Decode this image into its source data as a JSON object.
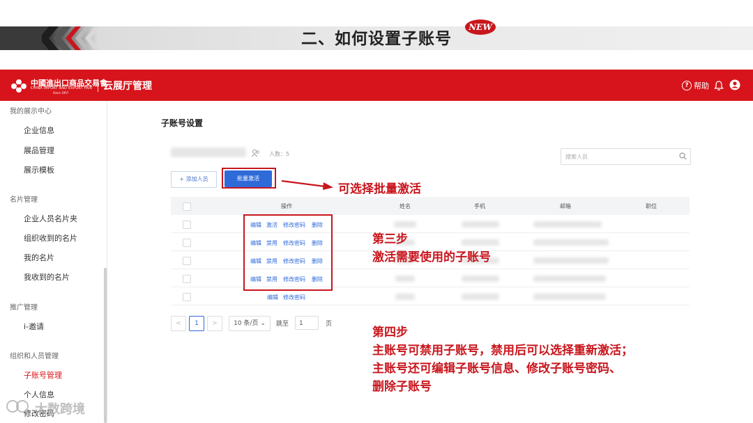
{
  "slide": {
    "title": "二、如何设置子账号",
    "badge": "NEW"
  },
  "header": {
    "logo_cn": "中國進出口商品交易會",
    "logo_en": "CHINA IMPORT AND EXPORT FAIR",
    "logo_since": "Since 1957",
    "app_title": "云展厅管理",
    "help_label": "帮助",
    "brand_color": "#d7141b"
  },
  "sidebar": {
    "groups": [
      {
        "title": "我的展示中心",
        "items": [
          "企业信息",
          "展品管理",
          "展示模板"
        ]
      },
      {
        "title": "名片管理",
        "items": [
          "企业人员名片夹",
          "组织收到的名片",
          "我的名片",
          "我收到的名片"
        ]
      },
      {
        "title": "推广管理",
        "items": [
          "i-邀请"
        ]
      },
      {
        "title": "组织和人员管理",
        "items": [
          "子账号管理",
          "个人信息",
          "修改密码"
        ]
      }
    ],
    "active_item": "子账号管理"
  },
  "main": {
    "page_title": "子账号设置",
    "member_count": "人数：5",
    "search_placeholder": "搜索人员",
    "add_button": "添加人员",
    "batch_button": "批量激活",
    "columns": [
      "操作",
      "姓名",
      "手机",
      "邮箱",
      "职位"
    ],
    "rows": [
      {
        "actions": [
          "编辑",
          "激活",
          "修改密码",
          "删除"
        ]
      },
      {
        "actions": [
          "编辑",
          "禁用",
          "修改密码",
          "删除"
        ]
      },
      {
        "actions": [
          "编辑",
          "禁用",
          "修改密码",
          "删除"
        ]
      },
      {
        "actions": [
          "编辑",
          "禁用",
          "修改密码",
          "删除"
        ]
      },
      {
        "actions": [
          "编辑",
          "修改密码"
        ]
      }
    ],
    "pagination": {
      "prev": "<",
      "current_page": "1",
      "next": ">",
      "page_size": "10 条/页",
      "goto_label": "跳至",
      "goto_value": "1",
      "page_unit": "页"
    }
  },
  "annotations": {
    "callout_batch": "可选择批量激活",
    "step3_title": "第三步",
    "step3_text": "激活需要使用的子账号",
    "step4_title": "第四步",
    "step4_line1": "主账号可禁用子账号，禁用后可以选择重新激活；",
    "step4_line2": "主账号还可编辑子账号信息、修改子账号密码、",
    "step4_line3": "删除子账号",
    "highlight_color": "#c8161d"
  },
  "watermark": "大数跨境"
}
